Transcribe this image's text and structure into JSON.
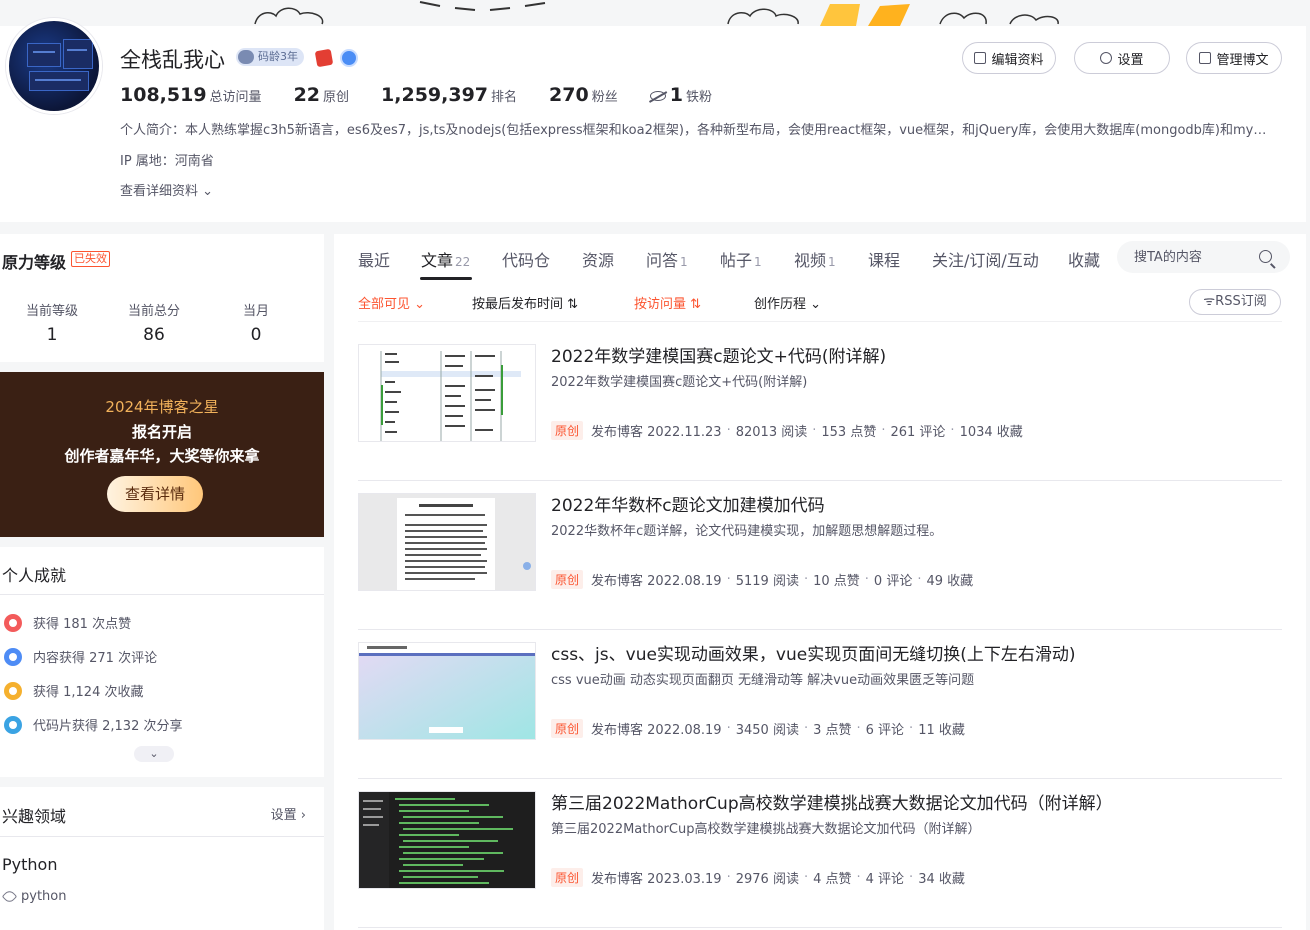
{
  "profile": {
    "name": "全栈乱我心",
    "code_age": "码龄3年",
    "stats": [
      {
        "value": "108,519",
        "label": "总访问量"
      },
      {
        "value": "22",
        "label": "原创"
      },
      {
        "value": "1,259,397",
        "label": "排名"
      },
      {
        "value": "270",
        "label": "粉丝"
      },
      {
        "value": "1",
        "label": "铁粉"
      }
    ],
    "intro": "个人简介：本人熟练掌握c3h5新语言，es6及es7，js,ts及nodejs(包括express框架和koa2框架)，各种新型布局，会使用react框架，vue框架，和jQuery库，会使用大数据库(mongodb库)和mysql数据库",
    "ip": "IP 属地：河南省",
    "more": "查看详细资料",
    "buttons": {
      "edit": "编辑资料",
      "settings": "设置",
      "manage": "管理博文"
    }
  },
  "force": {
    "title": "原力等级",
    "tag": "已失效",
    "cols": [
      {
        "label": "当前等级",
        "value": "1"
      },
      {
        "label": "当前总分",
        "value": "86"
      },
      {
        "label": "当月",
        "value": "0"
      }
    ]
  },
  "promo": {
    "line1": "2024年博客之星",
    "line2": "报名开启",
    "line3": "创作者嘉年华，大奖等你来拿",
    "button": "查看详情"
  },
  "achievements": {
    "title": "个人成就",
    "items": [
      {
        "text": "获得 181 次点赞",
        "color": "#f35b5b"
      },
      {
        "text": "内容获得 271 次评论",
        "color": "#4e8cf5"
      },
      {
        "text": "获得 1,124 次收藏",
        "color": "#f5b02e"
      },
      {
        "text": "代码片获得 2,132 次分享",
        "color": "#3aa3e3"
      }
    ]
  },
  "interest": {
    "title": "兴趣领域",
    "settings": "设置",
    "category": "Python",
    "tag": "python"
  },
  "tabs": [
    {
      "label": "最近",
      "count": ""
    },
    {
      "label": "文章",
      "count": "22"
    },
    {
      "label": "代码仓",
      "count": ""
    },
    {
      "label": "资源",
      "count": ""
    },
    {
      "label": "问答",
      "count": "1"
    },
    {
      "label": "帖子",
      "count": "1"
    },
    {
      "label": "视频",
      "count": "1"
    },
    {
      "label": "课程",
      "count": ""
    },
    {
      "label": "关注/订阅/互动",
      "count": ""
    },
    {
      "label": "收藏",
      "count": ""
    }
  ],
  "search": {
    "placeholder": "搜TA的内容"
  },
  "filters": {
    "visibility": "全部可见",
    "sort_time": "按最后发布时间",
    "sort_visits": "按访问量",
    "history": "创作历程",
    "rss": "RSS订阅"
  },
  "articles": [
    {
      "title": "2022年数学建模国赛c题论文+代码(附详解)",
      "desc": "2022年数学建模国赛c题论文+代码(附详解)",
      "tag": "原创",
      "published": "发布博客 2022.11.23",
      "reads": "82013 阅读",
      "likes": "153 点赞",
      "comments": "261 评论",
      "favorites": "1034 收藏"
    },
    {
      "title": "2022年华数杯c题论文加建模加代码",
      "desc": "2022华数杯年c题详解，论文代码建模实现，加解题思想解题过程。",
      "tag": "原创",
      "published": "发布博客 2022.08.19",
      "reads": "5119 阅读",
      "likes": "10 点赞",
      "comments": "0 评论",
      "favorites": "49 收藏"
    },
    {
      "title": "css、js、vue实现动画效果，vue实现页面间无缝切换(上下左右滑动)",
      "desc": "css vue动画 动态实现页面翻页 无缝滑动等 解决vue动画效果匮乏等问题",
      "tag": "原创",
      "published": "发布博客 2022.08.19",
      "reads": "3450 阅读",
      "likes": "3 点赞",
      "comments": "6 评论",
      "favorites": "11 收藏"
    },
    {
      "title": "第三届2022MathorCup高校数学建模挑战赛大数据论文加代码（附详解）",
      "desc": "第三届2022MathorCup高校数学建模挑战赛大数据论文加代码（附详解）",
      "tag": "原创",
      "published": "发布博客 2023.03.19",
      "reads": "2976 阅读",
      "likes": "4 点赞",
      "comments": "4 评论",
      "favorites": "34 收藏"
    }
  ]
}
